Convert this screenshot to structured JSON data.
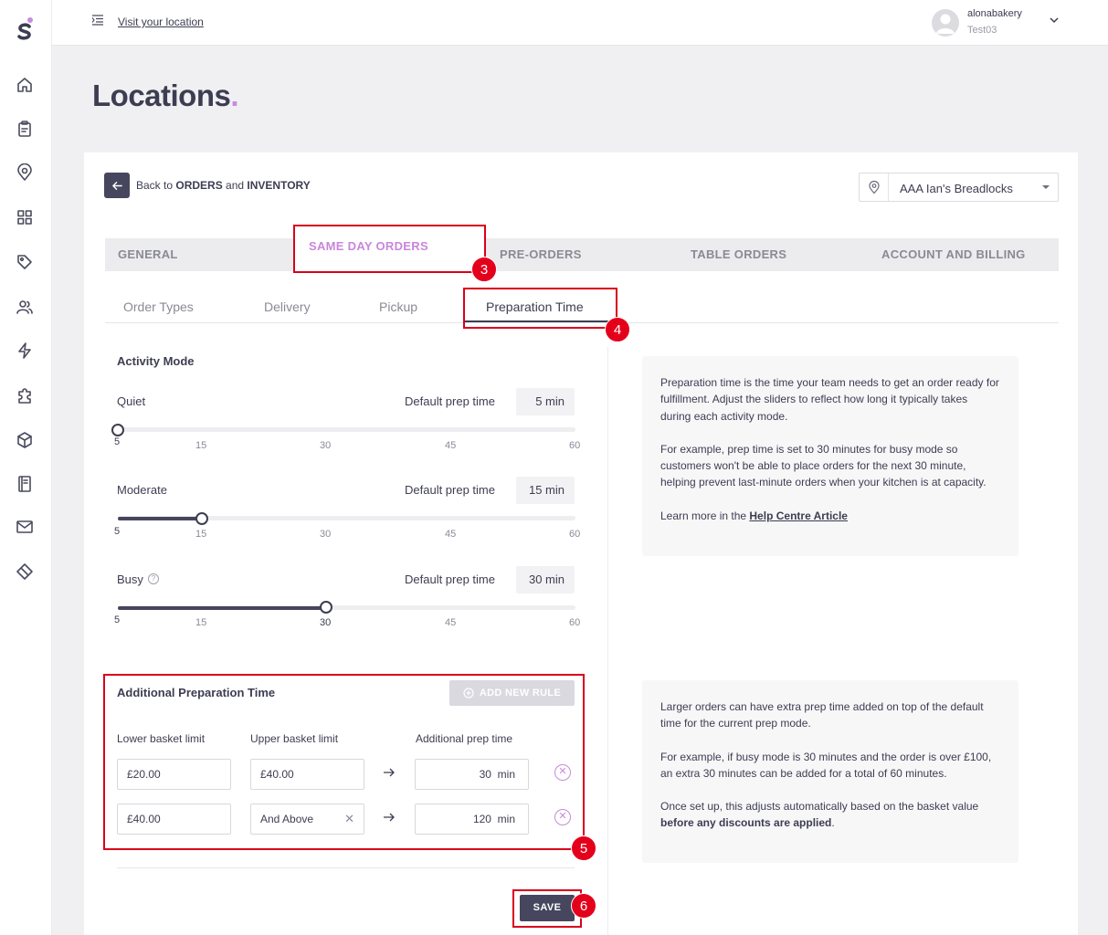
{
  "topbar": {
    "visit_link": "Visit your location",
    "user_name": "alonabakery",
    "user_sub": "Test03"
  },
  "sidebar": {
    "items": [
      "home-icon",
      "clipboard-icon",
      "location-pin-icon",
      "grid-icon",
      "tag-icon",
      "users-icon",
      "lightning-icon",
      "puzzle-icon",
      "box-icon",
      "book-icon",
      "mail-icon",
      "ticket-icon"
    ]
  },
  "page": {
    "title": "Locations",
    "title_dot": "."
  },
  "back": {
    "prefix": "Back to ",
    "orders": "ORDERS",
    "and": " and ",
    "inventory": "INVENTORY"
  },
  "location_select": {
    "value": "AAA Ian's Breadlocks"
  },
  "main_tabs": [
    "GENERAL",
    "SAME DAY ORDERS",
    "PRE-ORDERS",
    "TABLE ORDERS",
    "ACCOUNT AND BILLING"
  ],
  "sub_tabs": [
    "Order Types",
    "Delivery",
    "Pickup",
    "Preparation Time"
  ],
  "annotations": [
    "3",
    "4",
    "5",
    "6"
  ],
  "activity": {
    "title": "Activity Mode",
    "prep_label": "Default prep time",
    "ticks": [
      "5",
      "15",
      "30",
      "45",
      "60"
    ],
    "modes": [
      {
        "name": "Quiet",
        "value": "5 min",
        "minutes": 5
      },
      {
        "name": "Moderate",
        "value": "15 min",
        "minutes": 15
      },
      {
        "name": "Busy",
        "value": "30 min",
        "minutes": 30
      }
    ],
    "help_glyph": "?"
  },
  "info_top": {
    "p1": "Preparation time is the time your team needs to get an order ready for fulfillment. Adjust the sliders to reflect how long it typically takes during each activity mode.",
    "p2": "For example, prep time is set to 30 minutes for busy mode so customers won't be able to place orders for the next 30 minute, helping prevent last-minute orders when your kitchen is at capacity.",
    "p3_prefix": "Learn more in the ",
    "p3_link": "Help Centre Article"
  },
  "additional": {
    "title": "Additional Preparation Time",
    "add_rule": "ADD NEW RULE",
    "col_lower": "Lower basket limit",
    "col_upper": "Upper basket limit",
    "col_extra": "Additional prep time",
    "unit": "min",
    "rules": [
      {
        "lower": "£20.00",
        "upper": "£40.00",
        "extra": "30"
      },
      {
        "lower": "£40.00",
        "upper": "And Above",
        "extra": "120"
      }
    ]
  },
  "info_bottom": {
    "p1": "Larger orders can have extra prep time added on top of the default time for the current prep mode.",
    "p2": "For example, if busy mode is 30 minutes and the order is over £100, an extra 30 minutes can be added for a total of 60 minutes.",
    "p3_prefix": "Once set up, this adjusts automatically based on the basket value ",
    "p3_bold": "before any discounts are applied",
    "p3_suffix": "."
  },
  "save_label": "SAVE"
}
